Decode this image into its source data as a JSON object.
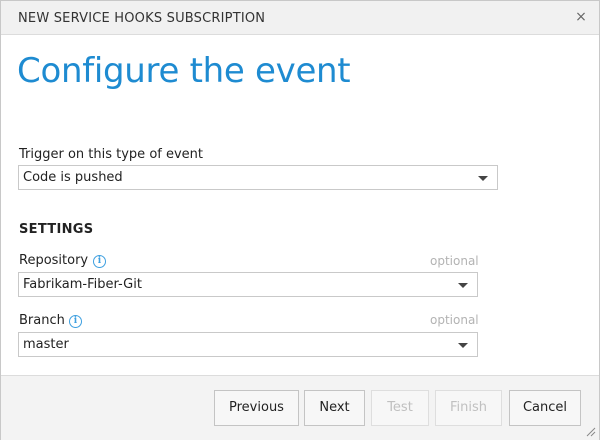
{
  "dialog": {
    "title": "NEW SERVICE HOOKS SUBSCRIPTION",
    "close_glyph": "×",
    "heading": "Configure the event"
  },
  "trigger": {
    "label": "Trigger on this type of event",
    "value": "Code is pushed"
  },
  "settings": {
    "title": "SETTINGS",
    "repository": {
      "label": "Repository",
      "optional": "optional",
      "value": "Fabrikam-Fiber-Git"
    },
    "branch": {
      "label": "Branch",
      "optional": "optional",
      "value": "master"
    }
  },
  "buttons": {
    "previous": "Previous",
    "next": "Next",
    "test": "Test",
    "finish": "Finish",
    "cancel": "Cancel"
  },
  "icons": {
    "info_glyph": "i",
    "close": "close-icon",
    "info": "info-icon",
    "dropdown": "chevron-down-icon",
    "resize": "resize-grip-icon"
  },
  "colors": {
    "accent": "#1e8bd1",
    "info": "#3fa0e0",
    "disabled_text": "#c0c0c0",
    "footer_bg": "#f3f3f3"
  }
}
